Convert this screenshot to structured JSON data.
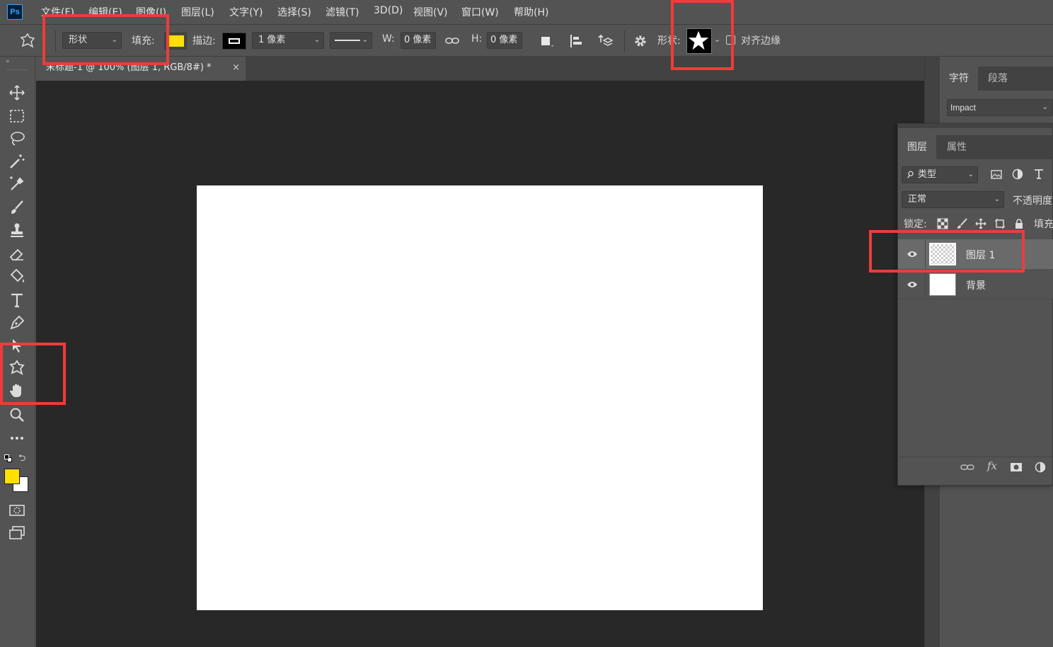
{
  "app": {
    "logo": "Ps"
  },
  "menu": [
    "文件(F)",
    "编辑(E)",
    "图像(I)",
    "图层(L)",
    "文字(Y)",
    "选择(S)",
    "滤镜(T)",
    "3D(D)",
    "视图(V)",
    "窗口(W)",
    "帮助(H)"
  ],
  "options": {
    "tool_icon": "custom-shape-tool-icon",
    "mode": "形状",
    "fill_label": "填充:",
    "fill_color": "#ffe000",
    "stroke_label": "描边:",
    "stroke_width": "1 像素",
    "w_label": "W:",
    "w_value": "0 像素",
    "h_label": "H:",
    "h_value": "0 像素",
    "shape_label": "形状:",
    "align_edges": "对齐边缘"
  },
  "document_tab": {
    "title": "未标题-1 @ 100% (图层 1, RGB/8#) *",
    "close": "×"
  },
  "tools": [
    "move-tool-icon",
    "marquee-tool-icon",
    "lasso-tool-icon",
    "magic-wand-icon",
    "eyedropper-icon",
    "brush-icon",
    "stamp-icon",
    "eraser-icon",
    "paint-bucket-icon",
    "type-tool-icon",
    "pen-tool-icon",
    "path-select-icon",
    "custom-shape-tool-icon",
    "hand-tool-icon",
    "zoom-tool-icon",
    "more-tools-icon"
  ],
  "colors": {
    "foreground": "#ffe000",
    "background": "#ffffff",
    "annotation": "#ef3b3b"
  },
  "character_panel": {
    "tabs": [
      "字符",
      "段落"
    ],
    "font": "Impact"
  },
  "layers_panel": {
    "tabs": [
      "图层",
      "属性"
    ],
    "filter": "类型",
    "blend_mode": "正常",
    "opacity_label": "不透明度",
    "lock_label": "锁定:",
    "fill_label": "填充",
    "layers": [
      {
        "name": "图层 1",
        "visible": true,
        "selected": true
      },
      {
        "name": "背景",
        "visible": true,
        "selected": false
      }
    ]
  }
}
